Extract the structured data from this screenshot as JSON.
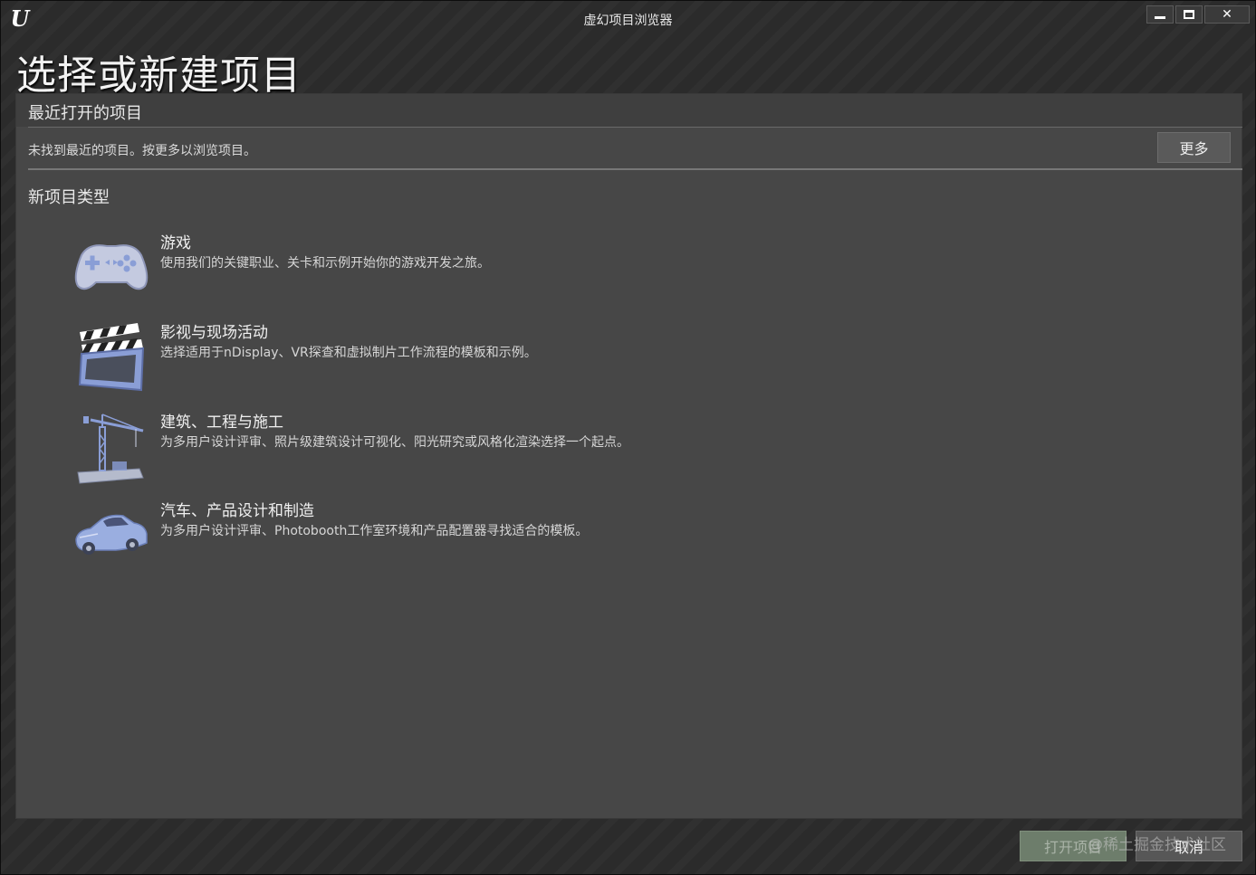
{
  "window": {
    "title": "虚幻项目浏览器",
    "logo": "U"
  },
  "page_title": "选择或新建项目",
  "recent": {
    "header": "最近打开的项目",
    "message": "未找到最近的项目。按更多以浏览项目。",
    "more_label": "更多"
  },
  "new_types": {
    "header": "新项目类型",
    "items": [
      {
        "name": "游戏",
        "desc": "使用我们的关键职业、关卡和示例开始你的游戏开发之旅。",
        "icon": "gamepad-icon"
      },
      {
        "name": "影视与现场活动",
        "desc": "选择适用于nDisplay、VR探查和虚拟制片工作流程的模板和示例。",
        "icon": "clapperboard-icon"
      },
      {
        "name": "建筑、工程与施工",
        "desc": "为多用户设计评审、照片级建筑设计可视化、阳光研究或风格化渲染选择一个起点。",
        "icon": "crane-icon"
      },
      {
        "name": "汽车、产品设计和制造",
        "desc": "为多用户设计评审、Photobooth工作室环境和产品配置器寻找适合的模板。",
        "icon": "car-icon"
      }
    ]
  },
  "footer": {
    "open_label": "打开项目",
    "cancel_label": "取消"
  },
  "watermark": "@稀土掘金技术社区",
  "colors": {
    "panel": "#474747",
    "background": "#2b2b2b",
    "icon_blue": "#8a9ed6"
  }
}
